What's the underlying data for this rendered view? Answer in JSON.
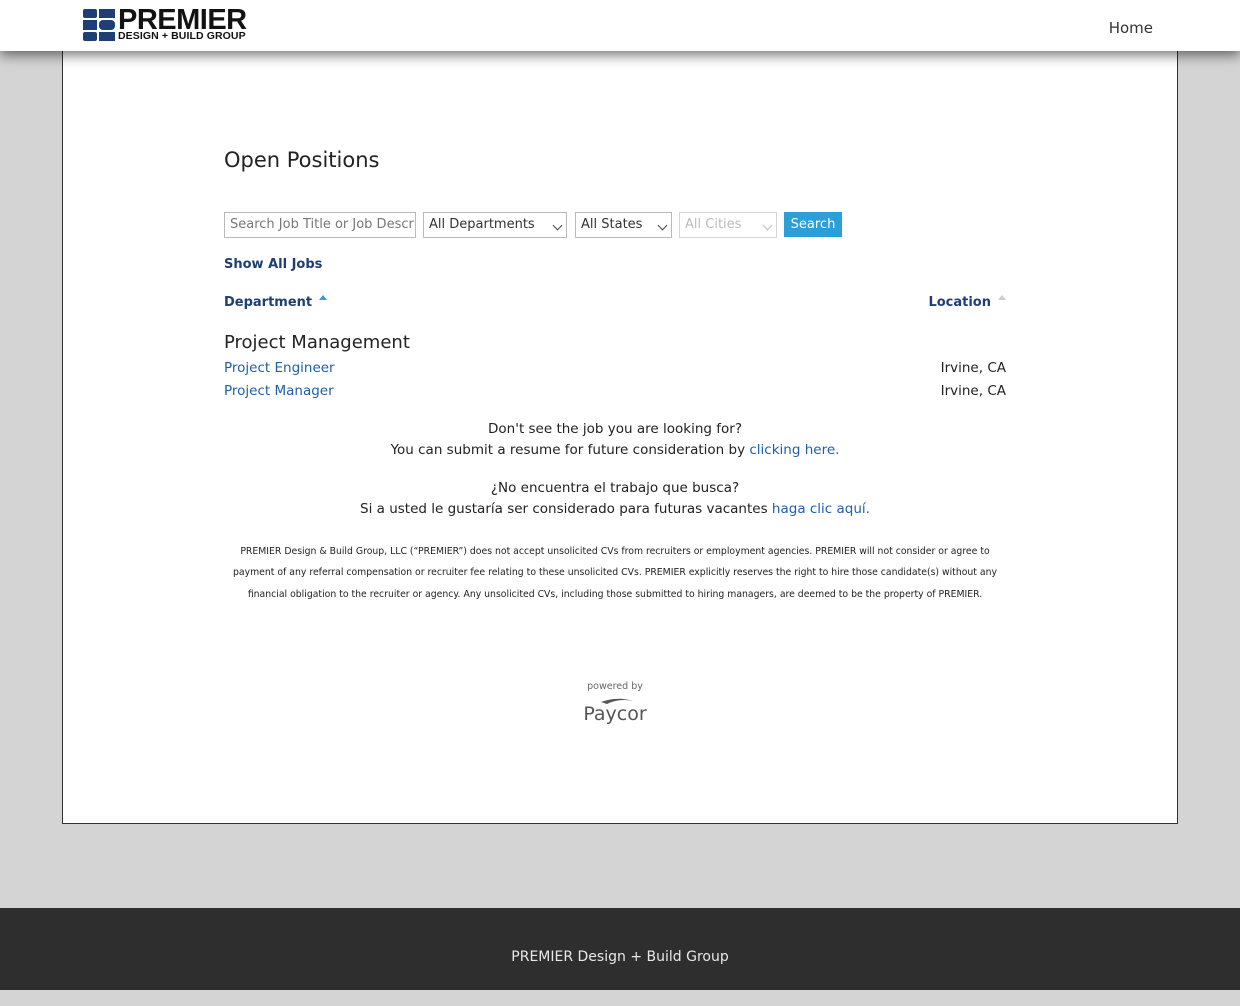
{
  "header": {
    "logo_title": "PREMIER",
    "logo_subtitle": "DESIGN + BUILD GROUP",
    "nav_home": "Home"
  },
  "main": {
    "title": "Open Positions",
    "filters": {
      "search_placeholder": "Search Job Title or Job Descrip",
      "department_selected": "All Departments",
      "state_selected": "All States",
      "city_selected": "All Cities",
      "search_button": "Search"
    },
    "show_all_jobs": "Show All Jobs",
    "columns": {
      "department": "Department",
      "location": "Location"
    },
    "departments": [
      {
        "name": "Project Management",
        "jobs": [
          {
            "title": "Project Engineer",
            "location": "Irvine, CA"
          },
          {
            "title": "Project Manager",
            "location": "Irvine, CA"
          }
        ]
      }
    ],
    "message_en": {
      "line1": "Don't see the job you are looking for?",
      "line2_prefix": "You can submit a resume for future consideration by ",
      "line2_link": "clicking here."
    },
    "message_es": {
      "line1": "¿No encuentra el trabajo que busca?",
      "line2_prefix": "Si a usted le gustaría ser considerado para futuras vacantes ",
      "line2_link": "haga clic aquí."
    },
    "disclaimer": "PREMIER Design & Build Group, LLC (“PREMIER”) does not accept unsolicited CVs from recruiters or employment agencies. PREMIER will not consider or agree to payment of any referral compensation or recruiter fee relating to these unsolicited CVs. PREMIER explicitly reserves the right to hire those candidate(s) without any financial obligation to the recruiter or agency. Any unsolicited CVs, including those submitted to hiring managers, are deemed to be the property of PREMIER.",
    "powered_by": "powered by",
    "paycor_logo_text": "Paycor"
  },
  "footer": {
    "text": "PREMIER Design + Build Group"
  },
  "colors": {
    "link": "#1f5fa8",
    "heading_link": "#1f3e73",
    "button": "#2a9fd8",
    "logo_blue": "#1f3e73",
    "footer_bg": "#2e2e2e",
    "page_bg": "#d4d4d4"
  },
  "icons": [
    "premier-logo-icon",
    "chevron-down-icon",
    "sort-ascending-icon",
    "paycor-logo"
  ]
}
